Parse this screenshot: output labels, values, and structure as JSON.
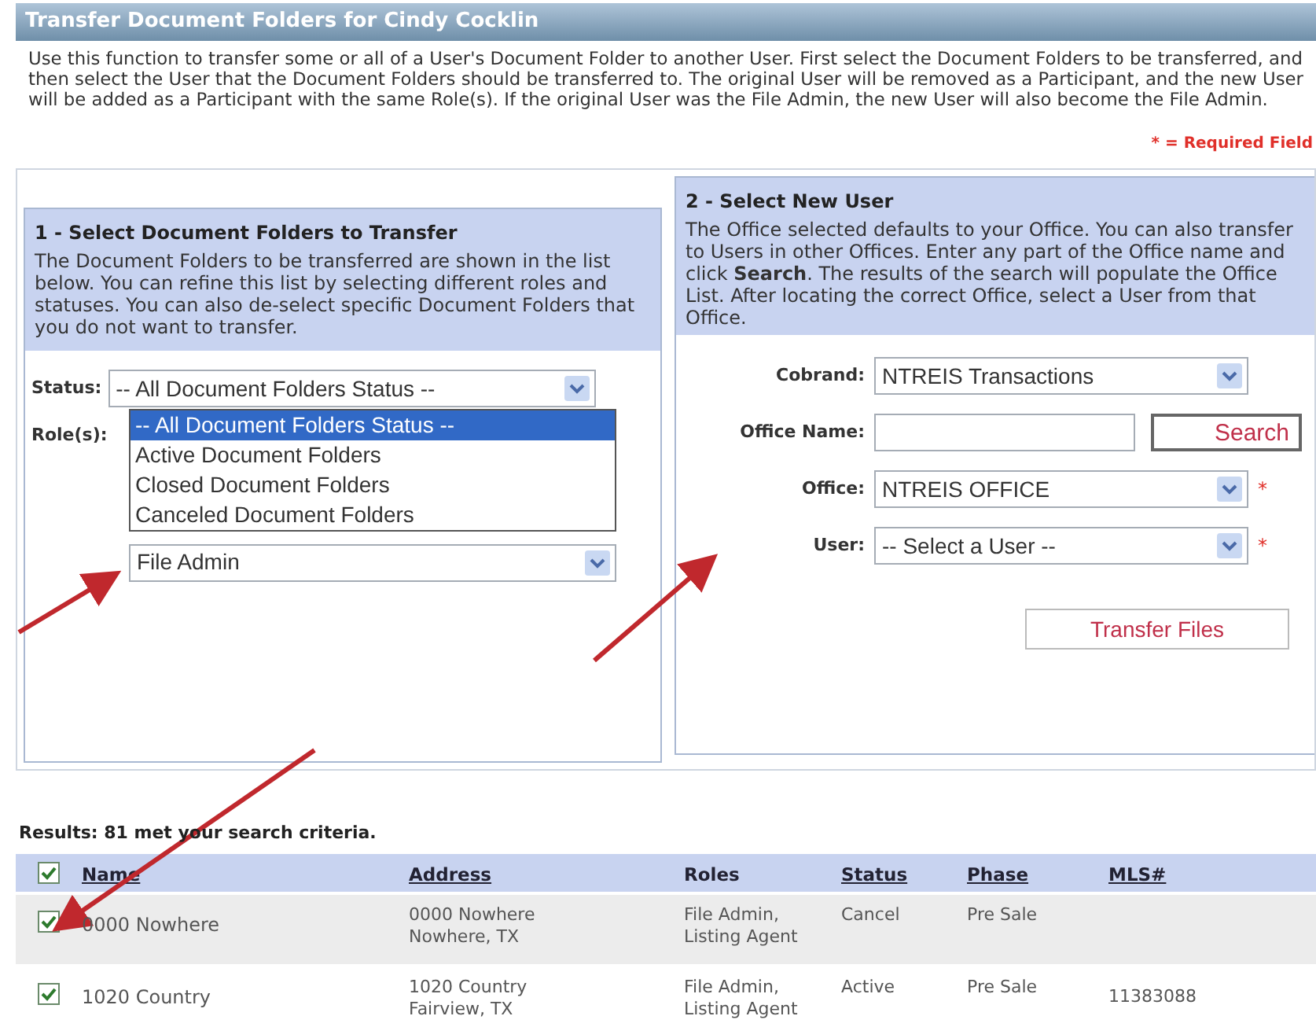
{
  "title": "Transfer Document Folders for Cindy Cocklin",
  "intro": "Use this function to transfer some or all of a User's Document Folder to another User. First select the Document Folders to be transferred, and then select the User that the Document Folders should be transferred to. The original User will be removed as a Participant, and the new User will be added as a Participant with the same Role(s). If the original User was the File Admin, the new User will also become the File Admin.",
  "required_note": "* = Required Field",
  "panel1": {
    "heading": "1 - Select Document Folders to Transfer",
    "text": "The Document Folders to be transferred are shown in the list below. You can refine this list by selecting different roles and statuses. You can also de-select specific Document Folders that you do not want to transfer.",
    "status_label": "Status:",
    "status_value": "-- All Document Folders Status --",
    "status_options": [
      {
        "label": "-- All Document Folders Status --",
        "selected": true
      },
      {
        "label": "Active Document Folders",
        "selected": false
      },
      {
        "label": "Closed Document Folders",
        "selected": false
      },
      {
        "label": "Canceled Document Folders",
        "selected": false
      }
    ],
    "roles_label": "Role(s):",
    "roles_value": "File Admin"
  },
  "panel2": {
    "heading": "2 - Select New User",
    "text": "The Office selected defaults to your Office. You can also transfer to Users in other Offices. Enter any part of the Office name and click **Search**. The results of the search will populate the Office List. After locating the correct Office, select a User from that Office.",
    "fields": [
      {
        "kind": "select",
        "label": "Cobrand:",
        "value": "NTREIS Transactions",
        "required": false
      },
      {
        "kind": "input",
        "label": "Office Name:",
        "button": "Search",
        "required": false
      },
      {
        "kind": "select",
        "label": "Office:",
        "value": "NTREIS OFFICE",
        "required": true
      },
      {
        "kind": "select",
        "label": "User:",
        "value": "-- Select a User --",
        "required": true
      }
    ],
    "required_mark": "*",
    "transfer_button": "Transfer Files"
  },
  "results": {
    "summary": "Results: 81 met your search criteria.",
    "all_checked": true,
    "columns": [
      {
        "label": "Name",
        "link": true
      },
      {
        "label": "Address",
        "link": true
      },
      {
        "label": "Roles",
        "link": false
      },
      {
        "label": "Status",
        "link": true
      },
      {
        "label": "Phase",
        "link": true
      },
      {
        "label": "MLS#",
        "link": true
      }
    ],
    "rows": [
      {
        "checked": true,
        "selected": true,
        "name": "0000 Nowhere",
        "address": [
          "0000 Nowhere",
          "Nowhere, TX"
        ],
        "roles": [
          "File Admin,",
          "Listing Agent"
        ],
        "status": "Cancel",
        "phase": "Pre Sale"
      },
      {
        "checked": true,
        "selected": false,
        "name": "1020 Country",
        "address": [
          "1020 Country",
          "Fairview, TX"
        ],
        "roles": [
          "File Admin,",
          "Listing Agent"
        ],
        "status": "Active",
        "phase": "Pre Sale",
        "mls": "11383088"
      }
    ]
  }
}
